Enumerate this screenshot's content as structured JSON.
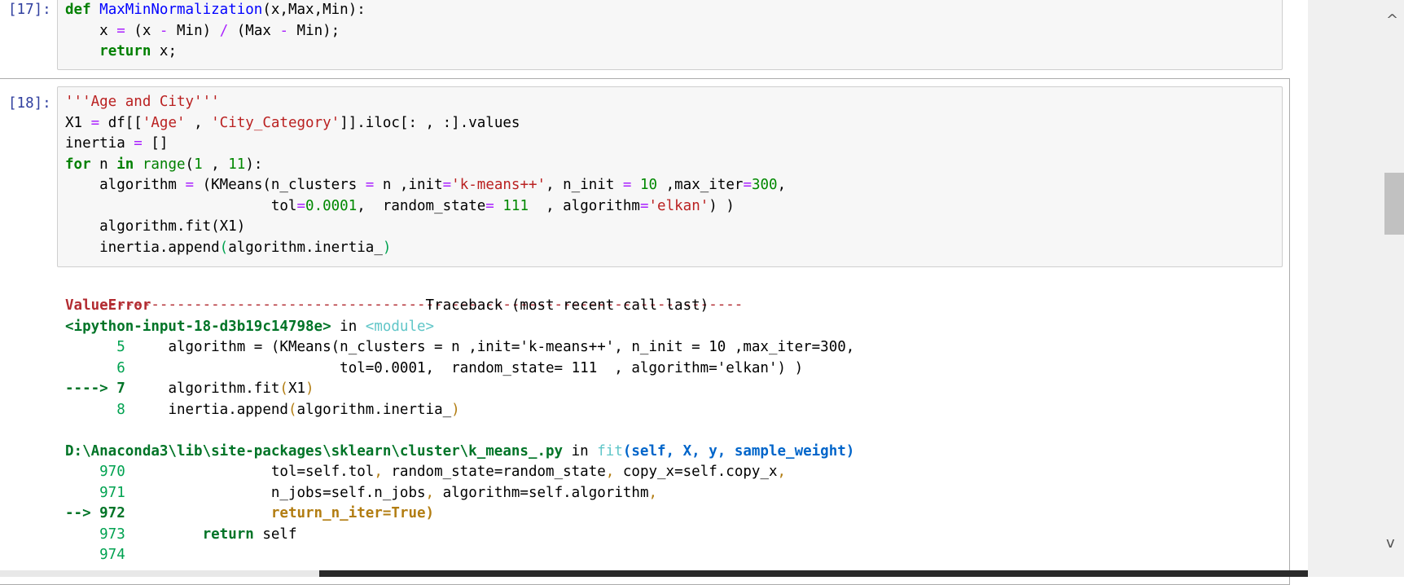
{
  "cells": [
    {
      "prompt": "[17]:",
      "lines": [
        [
          [
            "kw",
            "def"
          ],
          [
            "plain",
            " "
          ],
          [
            "fn",
            "MaxMinNormalization"
          ],
          [
            "plain",
            "(x,Max,Min):"
          ]
        ],
        [
          [
            "plain",
            "    x "
          ],
          [
            "op",
            "="
          ],
          [
            "plain",
            " (x "
          ],
          [
            "op",
            "-"
          ],
          [
            "plain",
            " Min) "
          ],
          [
            "op",
            "/"
          ],
          [
            "plain",
            " (Max "
          ],
          [
            "op",
            "-"
          ],
          [
            "plain",
            " Min);"
          ]
        ],
        [
          [
            "plain",
            "    "
          ],
          [
            "kw",
            "return"
          ],
          [
            "plain",
            " x;"
          ]
        ]
      ]
    },
    {
      "prompt": "[18]:",
      "lines": [
        [
          [
            "str",
            "'''Age and City'''"
          ]
        ],
        [
          [
            "plain",
            "X1 "
          ],
          [
            "op",
            "="
          ],
          [
            "plain",
            " df[["
          ],
          [
            "str",
            "'Age'"
          ],
          [
            "plain",
            " , "
          ],
          [
            "str",
            "'City_Category'"
          ],
          [
            "plain",
            "]].iloc[: , :].values"
          ]
        ],
        [
          [
            "plain",
            "inertia "
          ],
          [
            "op",
            "="
          ],
          [
            "plain",
            " []"
          ]
        ],
        [
          [
            "kw",
            "for"
          ],
          [
            "plain",
            " n "
          ],
          [
            "kw",
            "in"
          ],
          [
            "plain",
            " "
          ],
          [
            "bi",
            "range"
          ],
          [
            "plain",
            "("
          ],
          [
            "num",
            "1"
          ],
          [
            "plain",
            " , "
          ],
          [
            "num",
            "11"
          ],
          [
            "plain",
            "):"
          ]
        ],
        [
          [
            "plain",
            "    algorithm "
          ],
          [
            "op",
            "="
          ],
          [
            "plain",
            " (KMeans(n_clusters "
          ],
          [
            "op",
            "="
          ],
          [
            "plain",
            " n ,init"
          ],
          [
            "op",
            "="
          ],
          [
            "str",
            "'k-means++'"
          ],
          [
            "plain",
            ", n_init "
          ],
          [
            "op",
            "="
          ],
          [
            "plain",
            " "
          ],
          [
            "num",
            "10"
          ],
          [
            "plain",
            " ,max_iter"
          ],
          [
            "op",
            "="
          ],
          [
            "num",
            "300"
          ],
          [
            "plain",
            ","
          ]
        ],
        [
          [
            "plain",
            "                        tol"
          ],
          [
            "op",
            "="
          ],
          [
            "num",
            "0.0001"
          ],
          [
            "plain",
            ",  random_state"
          ],
          [
            "op",
            "="
          ],
          [
            "plain",
            " "
          ],
          [
            "num",
            "111"
          ],
          [
            "plain",
            "  , algorithm"
          ],
          [
            "op",
            "="
          ],
          [
            "str",
            "'elkan'"
          ],
          [
            "plain",
            ") )"
          ]
        ],
        [
          [
            "plain",
            "    algorithm.fit(X1)"
          ]
        ],
        [
          [
            "plain",
            "    inertia.append"
          ],
          [
            "grn",
            "("
          ],
          [
            "plain",
            "algorithm.inertia_"
          ],
          [
            "grn",
            ")"
          ]
        ]
      ]
    }
  ],
  "traceback": {
    "separator": "---------------------------------------------------------------------------",
    "lines": [
      [
        [
          "red",
          "ValueError"
        ],
        [
          "plain",
          "                                Traceback (most recent call last)"
        ]
      ],
      [
        [
          "grnb",
          "<ipython-input-18-d3b19c14798e>"
        ],
        [
          "plain",
          " in "
        ],
        [
          "cyan",
          "<module>"
        ]
      ],
      [
        [
          "grn",
          "      5"
        ],
        [
          "plain",
          "     algorithm = (KMeans(n_clusters = n ,init='k-means++', n_init = 10 ,max_iter=300,"
        ]
      ],
      [
        [
          "grn",
          "      6"
        ],
        [
          "plain",
          "                         tol=0.0001,  random_state= 111  , algorithm='elkan') )"
        ]
      ],
      [
        [
          "grnb",
          "----> 7"
        ],
        [
          "plain",
          "     algorithm.fit"
        ],
        [
          "ylw",
          "("
        ],
        [
          "plain",
          "X1"
        ],
        [
          "ylw",
          ")"
        ]
      ],
      [
        [
          "grn",
          "      8"
        ],
        [
          "plain",
          "     inertia.append"
        ],
        [
          "ylw",
          "("
        ],
        [
          "plain",
          "algorithm.inertia_"
        ],
        [
          "ylw",
          ")"
        ]
      ],
      [
        [
          "plain",
          " "
        ]
      ],
      [
        [
          "grnb",
          "D:\\Anaconda3\\lib\\site-packages\\sklearn\\cluster\\k_means_.py"
        ],
        [
          "plain",
          " in "
        ],
        [
          "cyan",
          "fit"
        ],
        [
          "blub",
          "(self, X, y, sample_weight)"
        ]
      ],
      [
        [
          "grn",
          "    970"
        ],
        [
          "plain",
          "                 tol=self.tol"
        ],
        [
          "ylw",
          ","
        ],
        [
          "plain",
          " random_state=random_state"
        ],
        [
          "ylw",
          ","
        ],
        [
          "plain",
          " copy_x=self.copy_x"
        ],
        [
          "ylw",
          ","
        ]
      ],
      [
        [
          "grn",
          "    971"
        ],
        [
          "plain",
          "                 n_jobs=self.n_jobs"
        ],
        [
          "ylw",
          ","
        ],
        [
          "plain",
          " algorithm=self.algorithm"
        ],
        [
          "ylw",
          ","
        ]
      ],
      [
        [
          "grnb",
          "--> 972"
        ],
        [
          "ylwb",
          "                 return_n_iter=True)"
        ]
      ],
      [
        [
          "grn",
          "    973"
        ],
        [
          "plain",
          "         "
        ],
        [
          "grnb",
          "return"
        ],
        [
          "plain",
          " self"
        ]
      ],
      [
        [
          "grn",
          "    974"
        ]
      ]
    ]
  },
  "scrollbar": {
    "up_icon": "^",
    "down_icon": "v"
  }
}
